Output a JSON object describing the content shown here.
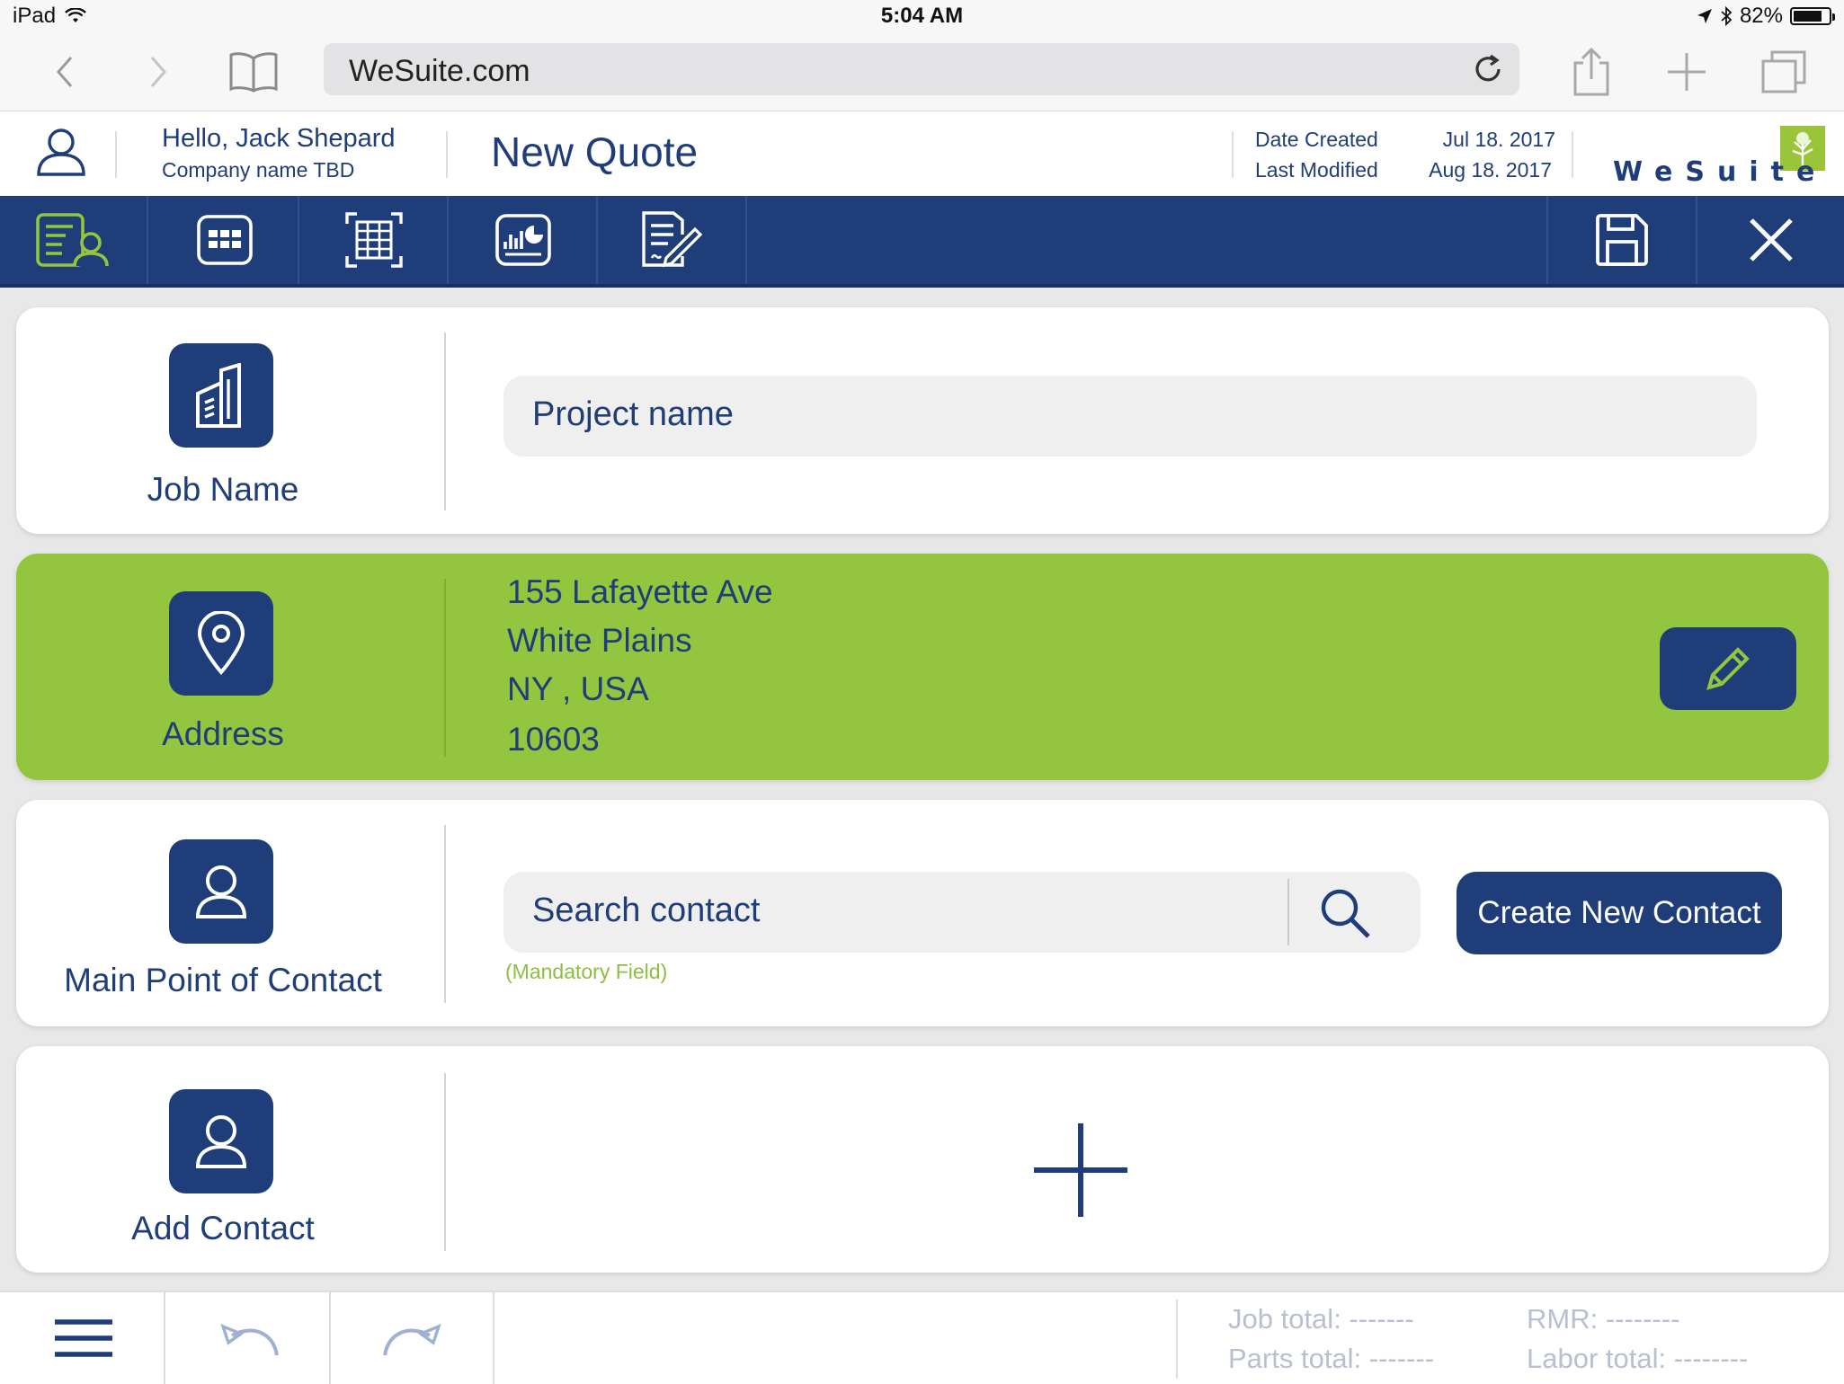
{
  "status_bar": {
    "device": "iPad",
    "time": "5:04 AM",
    "battery": "82%",
    "battery_level": 0.82
  },
  "browser": {
    "url": "WeSuite.com"
  },
  "header": {
    "greeting": "Hello, Jack Shepard",
    "company": "Company name TBD",
    "title": "New Quote",
    "date_created_label": "Date Created",
    "date_created_value": "Jul 18. 2017",
    "last_modified_label": "Last Modified",
    "last_modified_value": "Aug 18. 2017",
    "logo_text": "WeSuite"
  },
  "nav": {
    "items": [
      "customer-info-icon",
      "grid-icon",
      "table-icon",
      "report-icon",
      "sign-document-icon"
    ],
    "save_icon": "save-icon",
    "close_icon": "close-icon"
  },
  "job": {
    "label": "Job Name",
    "placeholder": "Project name"
  },
  "address": {
    "label": "Address",
    "line1": "155 Lafayette Ave",
    "line2": "White Plains",
    "line3": "NY , USA",
    "line4": "10603"
  },
  "contact": {
    "label": "Main Point of Contact",
    "search_placeholder": "Search contact",
    "mandatory": "(Mandatory Field)",
    "create_button": "Create New Contact"
  },
  "add_contact": {
    "label": "Add Contact"
  },
  "footer": {
    "job_total": "Job total: -------",
    "parts_total": "Parts total: -------",
    "rmr": "RMR: --------",
    "labor_total": "Labor total: --------"
  },
  "colors": {
    "primary": "#1f3d78",
    "accent_green": "#94c53f",
    "mandatory_green": "#8cbf3f"
  }
}
